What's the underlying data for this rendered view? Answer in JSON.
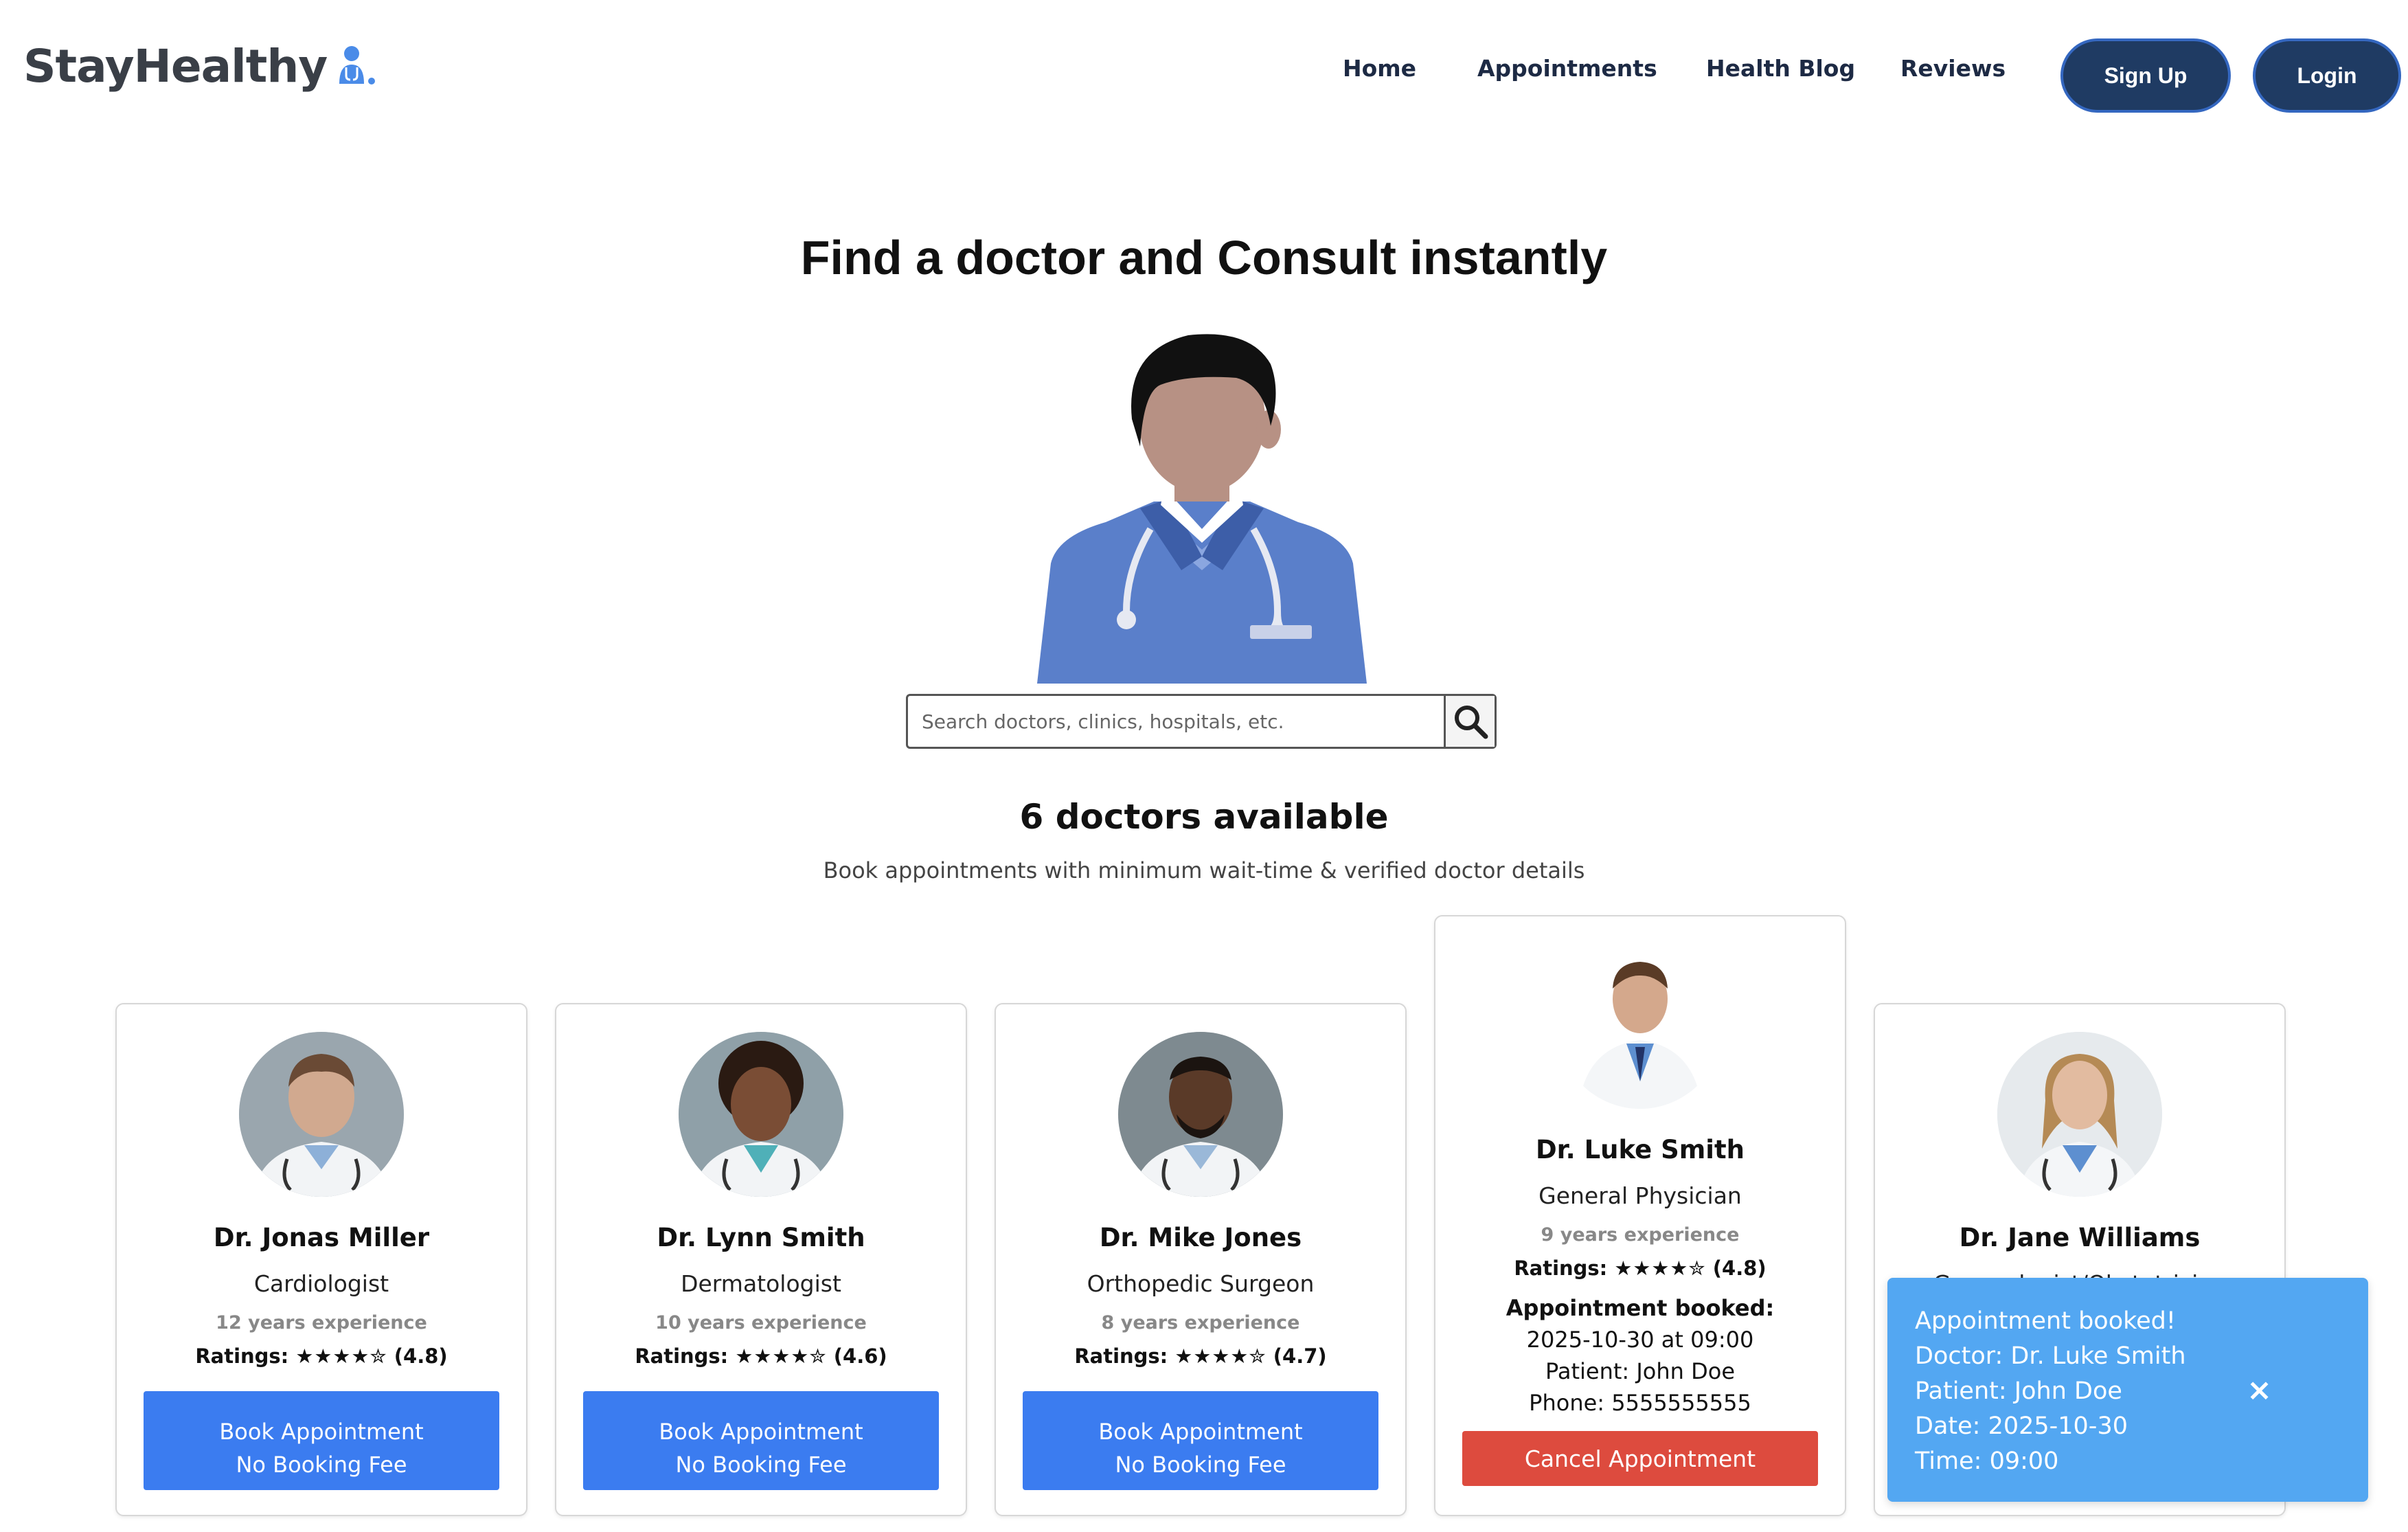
{
  "brand": {
    "name": "StayHealthy",
    "icon": "doctor-icon"
  },
  "nav": {
    "links": [
      "Home",
      "Appointments",
      "Health Blog",
      "Reviews"
    ],
    "signup_label": "Sign Up",
    "login_label": "Login"
  },
  "hero": {
    "title": "Find a doctor and Consult instantly",
    "search_placeholder": "Search doctors, clinics, hospitals, etc."
  },
  "listing": {
    "count_title": "6 doctors available",
    "subtitle": "Book appointments with minimum wait-time & verified doctor details"
  },
  "doctors": [
    {
      "name": "Dr. Jonas Miller",
      "specialty": "Cardiologist",
      "experience": "12 years experience",
      "ratings_label": "Ratings:",
      "stars": "★★★★✮",
      "rating": "(4.8)",
      "book_line1": "Book Appointment",
      "book_line2": "No Booking Fee"
    },
    {
      "name": "Dr. Lynn Smith",
      "specialty": "Dermatologist",
      "experience": "10 years experience",
      "ratings_label": "Ratings:",
      "stars": "★★★★✮",
      "rating": "(4.6)",
      "book_line1": "Book Appointment",
      "book_line2": "No Booking Fee"
    },
    {
      "name": "Dr. Mike Jones",
      "specialty": "Orthopedic Surgeon",
      "experience": "8 years experience",
      "ratings_label": "Ratings:",
      "stars": "★★★★✮",
      "rating": "(4.7)",
      "book_line1": "Book Appointment",
      "book_line2": "No Booking Fee"
    },
    {
      "name": "Dr. Luke Smith",
      "specialty": "General Physician",
      "experience": "9 years experience",
      "ratings_label": "Ratings:",
      "stars": "★★★★✮",
      "rating": "(4.8)",
      "booked_label": "Appointment booked:",
      "booked_datetime": "2025-10-30 at 09:00",
      "booked_patient": "Patient: John Doe",
      "booked_phone": "Phone: 5555555555",
      "cancel_label": "Cancel Appointment"
    },
    {
      "name": "Dr. Jane Williams",
      "specialty": "Gynecologist/Obstetrician"
    }
  ],
  "toast": {
    "lines": [
      "Appointment booked!",
      "Doctor: Dr. Luke Smith",
      "Patient: John Doe",
      "Date: 2025-10-30",
      "Time: 09:00"
    ],
    "close": "×"
  },
  "colors": {
    "primary_blue": "#3b7cf0",
    "nav_dark": "#1f3b63",
    "cancel_red": "#dd4b3e",
    "toast_blue": "#53a7f2"
  }
}
